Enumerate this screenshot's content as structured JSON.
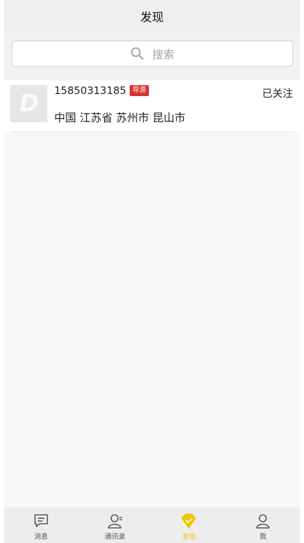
{
  "header": {
    "title": "发现"
  },
  "search": {
    "placeholder": "搜索",
    "icon": "search-icon"
  },
  "list": {
    "items": [
      {
        "avatar_letter": "D",
        "phone": "15850313185",
        "badge": "导游",
        "location": "中国 江苏省 苏州市 昆山市",
        "follow_status": "已关注"
      }
    ]
  },
  "tabbar": {
    "tabs": [
      {
        "label": "消息",
        "icon": "message-icon",
        "active": false
      },
      {
        "label": "通讯录",
        "icon": "contacts-icon",
        "active": false
      },
      {
        "label": "发现",
        "icon": "discover-icon",
        "active": true
      },
      {
        "label": "我",
        "icon": "profile-icon",
        "active": false
      }
    ]
  },
  "colors": {
    "accent": "#f2c500",
    "badge": "#d8322d",
    "header_bg": "#efefef"
  }
}
